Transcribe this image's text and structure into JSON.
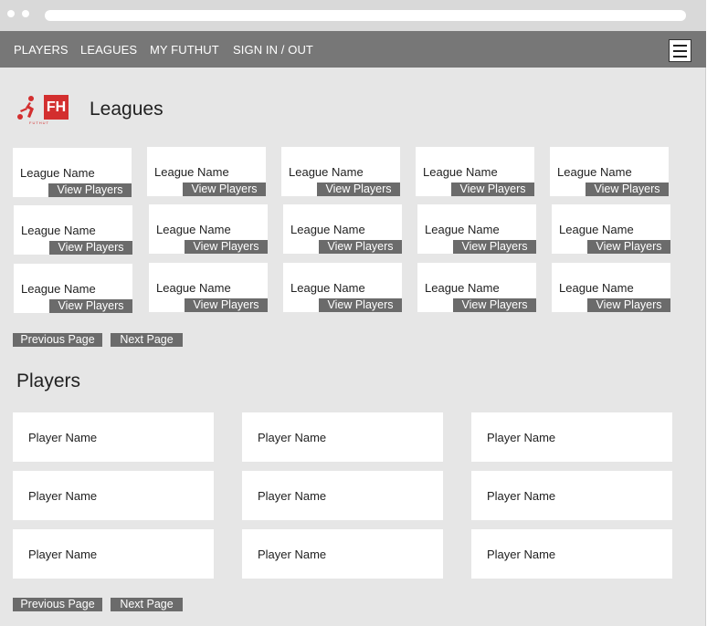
{
  "nav": {
    "items": [
      "PLAYERS",
      "LEAGUES",
      "MY FUTHUT",
      "SIGN IN / OUT"
    ]
  },
  "logo": {
    "mark": "FH",
    "sub": "FUTHUT"
  },
  "leagues": {
    "title": "Leagues",
    "cards": [
      {
        "name": "League Name",
        "action": "View Players"
      },
      {
        "name": "League Name",
        "action": "View Players"
      },
      {
        "name": "League Name",
        "action": "View Players"
      },
      {
        "name": "League Name",
        "action": "View Players"
      },
      {
        "name": "League Name",
        "action": "View Players"
      },
      {
        "name": "League Name",
        "action": "View Players"
      },
      {
        "name": "League Name",
        "action": "View Players"
      },
      {
        "name": "League Name",
        "action": "View Players"
      },
      {
        "name": "League Name",
        "action": "View Players"
      },
      {
        "name": "League Name",
        "action": "View Players"
      },
      {
        "name": "League Name",
        "action": "View Players"
      },
      {
        "name": "League Name",
        "action": "View Players"
      },
      {
        "name": "League Name",
        "action": "View Players"
      },
      {
        "name": "League Name",
        "action": "View Players"
      },
      {
        "name": "League Name",
        "action": "View Players"
      }
    ],
    "prev_label": "Previous Page",
    "next_label": "Next Page"
  },
  "players": {
    "title": "Players",
    "cards": [
      {
        "name": "Player Name"
      },
      {
        "name": "Player Name"
      },
      {
        "name": "Player Name"
      },
      {
        "name": "Player Name"
      },
      {
        "name": "Player Name"
      },
      {
        "name": "Player Name"
      },
      {
        "name": "Player Name"
      },
      {
        "name": "Player Name"
      },
      {
        "name": "Player Name"
      }
    ],
    "prev_label": "Previous Page",
    "next_label": "Next Page"
  }
}
